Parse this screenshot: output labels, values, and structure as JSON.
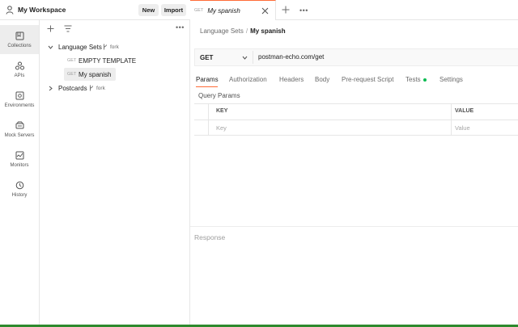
{
  "workspace": {
    "title": "My Workspace",
    "new_label": "New",
    "import_label": "Import"
  },
  "tab_bar": {
    "active_tab": {
      "method": "GET",
      "name": "My spanish"
    }
  },
  "sidebar": {
    "items": [
      {
        "label": "Collections",
        "icon": "collections-icon",
        "active": true
      },
      {
        "label": "APIs",
        "icon": "apis-icon"
      },
      {
        "label": "Environments",
        "icon": "environments-icon"
      },
      {
        "label": "Mock Servers",
        "icon": "mock-servers-icon"
      },
      {
        "label": "Monitors",
        "icon": "monitors-icon"
      },
      {
        "label": "History",
        "icon": "history-icon"
      }
    ]
  },
  "collections": {
    "tree": [
      {
        "name": "Language Sets",
        "fork_label": "fork",
        "expanded": true,
        "children": [
          {
            "method": "GET",
            "name": "EMPTY TEMPLATE"
          },
          {
            "method": "GET",
            "name": "My spanish",
            "selected": true
          }
        ]
      },
      {
        "name": "Postcards",
        "fork_label": "fork",
        "expanded": false
      }
    ]
  },
  "request": {
    "breadcrumb": {
      "parent": "Language Sets",
      "separator": "/",
      "current": "My spanish"
    },
    "method": "GET",
    "url": "postman-echo.com/get",
    "tabs": [
      "Params",
      "Authorization",
      "Headers",
      "Body",
      "Pre-request Script",
      "Tests",
      "Settings"
    ],
    "active_tab": "Params",
    "query_params": {
      "title": "Query Params",
      "key_header": "KEY",
      "value_header": "VALUE",
      "key_placeholder": "Key",
      "value_placeholder": "Value"
    }
  },
  "response": {
    "label": "Response"
  },
  "colors": {
    "accent": "#ff6c37",
    "tests_indicator": "#0cbb52",
    "status_strip": "#2d8a2d"
  }
}
